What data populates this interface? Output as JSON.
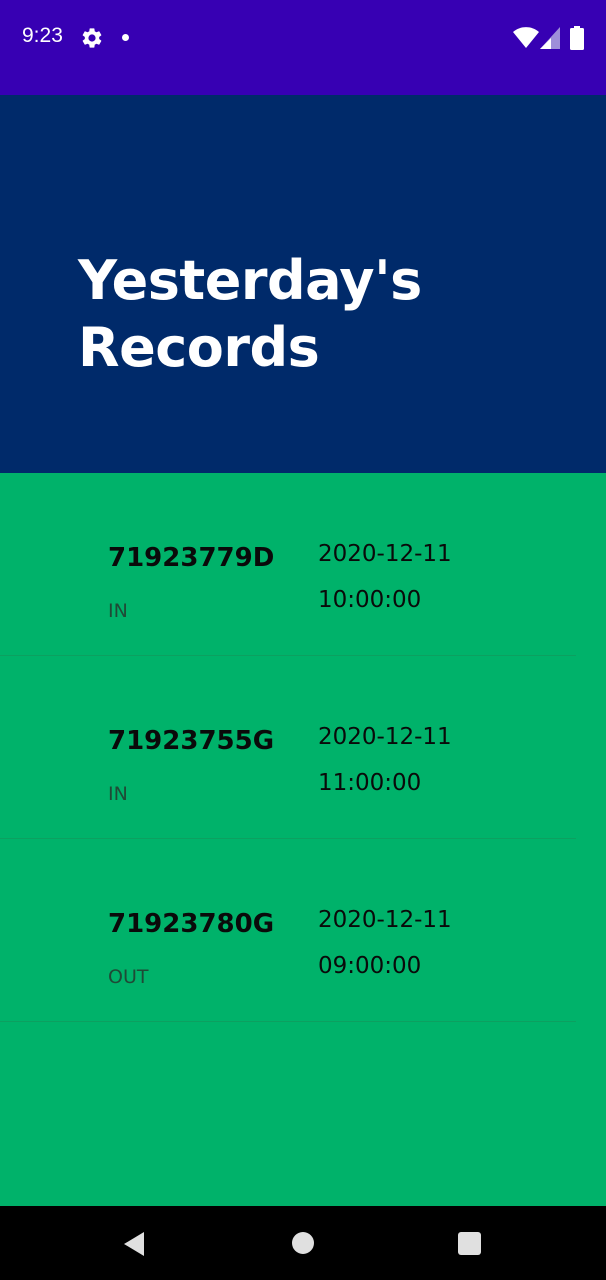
{
  "status_bar": {
    "time": "9:23",
    "icons": [
      "gear-icon",
      "notification-dot-icon",
      "wifi-icon",
      "signal-icon",
      "battery-icon"
    ],
    "background": "#3700b3"
  },
  "header": {
    "title": "Yesterday's Records",
    "background": "#002a6a"
  },
  "records": [
    {
      "id": "71923779D",
      "direction": "IN",
      "date": "2020-12-11",
      "time": "10:00:00"
    },
    {
      "id": "71923755G",
      "direction": "IN",
      "date": "2020-12-11",
      "time": "11:00:00"
    },
    {
      "id": "71923780G",
      "direction": "OUT",
      "date": "2020-12-11",
      "time": "09:00:00"
    }
  ],
  "list_background": "#00b26a",
  "nav_bar": {
    "buttons": [
      "back-icon",
      "home-icon",
      "recents-icon"
    ]
  }
}
